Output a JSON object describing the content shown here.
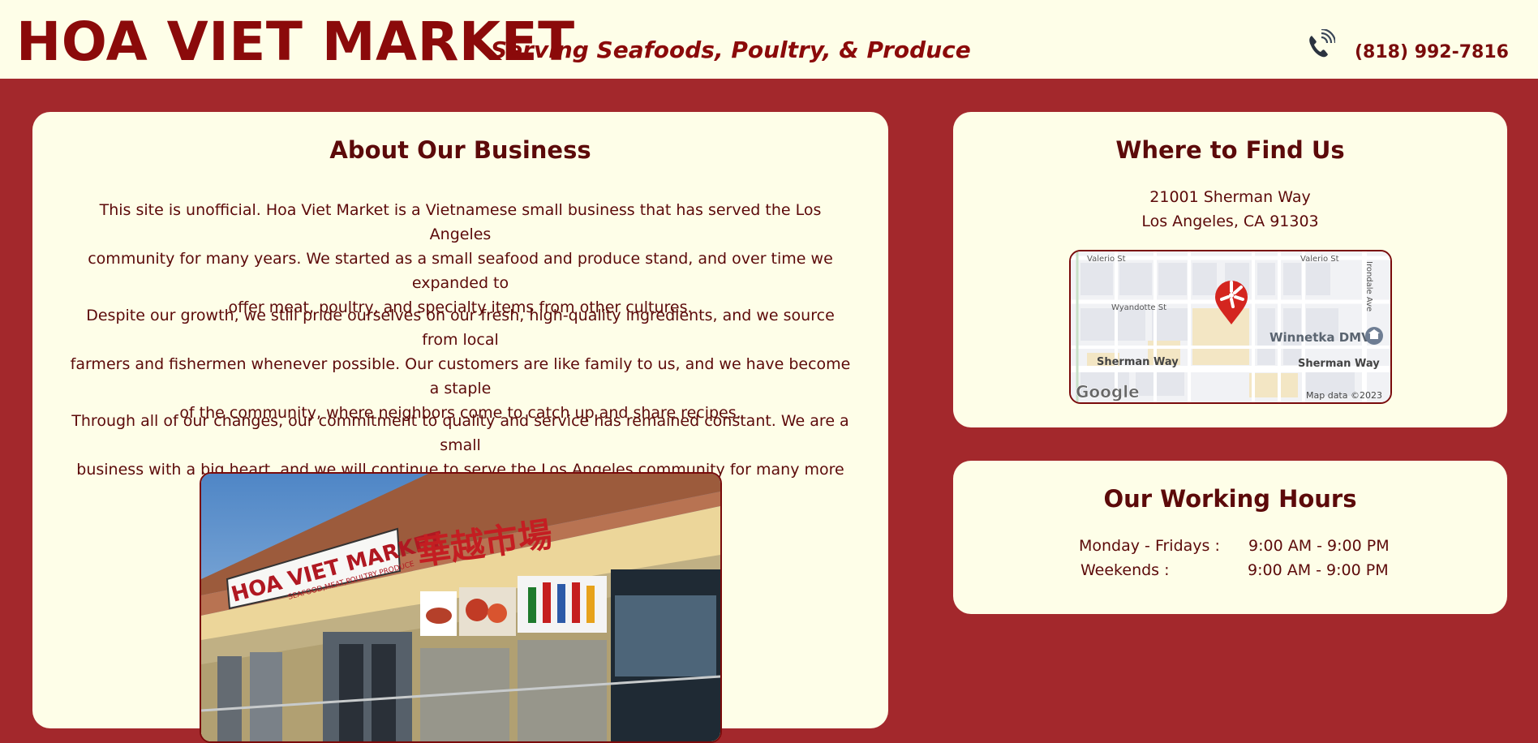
{
  "header": {
    "brand": "HOA VIET MARKET",
    "tagline": "Serving Seafoods, Poultry, & Produce",
    "phone": "(818) 992-7816",
    "phone_icon": "phone-icon"
  },
  "about": {
    "title": "About Our Business",
    "p1_l1": "This site is unofficial. Hoa Viet Market is a Vietnamese small business that has served the Los Angeles",
    "p1_l2": "community for many years. We started as a small seafood and produce stand, and over time we expanded to",
    "p1_l3": "offer meat, poultry, and specialty items from other cultures.",
    "p2_l1": "Despite our growth, we still pride ourselves on our fresh, high-quality ingredients, and we source from local",
    "p2_l2": "farmers and fishermen whenever possible. Our customers are like family to us, and we have become a staple",
    "p2_l3": "of the community, where neighbors come to catch up and share recipes.",
    "p3_l1": "Through all of our changes, our commitment to quality and service has remained constant. We are a small",
    "p3_l2": "business with a big heart, and we will continue to serve the Los Angeles community for many more years.",
    "sign_name": "HOA VIET MARKET",
    "sign_sub": "SEAFOOD,MEAT,POULTRY,PRODUCE",
    "sign_chinese": "華越市場"
  },
  "find": {
    "title": "Where to Find Us",
    "address_line1": "21001 Sherman Way",
    "address_line2": "Los Angeles, CA 91303",
    "map": {
      "street_valerio_left": "Valerio St",
      "street_valerio_right": "Valerio St",
      "street_wyandotte": "Wyandotte St",
      "street_irondale": "Irondale Ave",
      "place_dmv": "Winnetka DMV",
      "street_sherman_left": "Sherman Way",
      "street_sherman_right": "Sherman Way",
      "logo": "Google",
      "attribution": "Map data ©2023"
    }
  },
  "hours": {
    "title": "Our Working Hours",
    "rows": [
      {
        "day": "Monday - Fridays :",
        "time": "9:00 AM - 9:00 PM"
      },
      {
        "day": "Weekends :",
        "time": "9:00 AM - 9:00 PM"
      }
    ]
  },
  "colors": {
    "page_background": "#a3282c",
    "card_background": "#fefee8",
    "brand_red": "#8b0a0a",
    "text_dark": "#5c0a0a"
  }
}
